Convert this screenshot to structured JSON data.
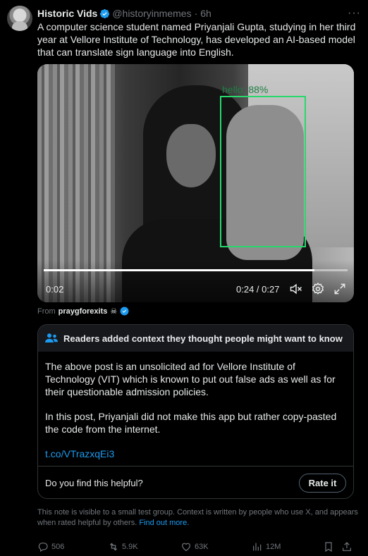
{
  "author": {
    "name": "Historic Vids",
    "handle": "@historyinmemes",
    "separator": "·",
    "time": "6h",
    "more": "···"
  },
  "tweet": {
    "text": "A computer science student named Priyanjali Gupta, studying in her third year at Vellore Institute of Technology, has developed an AI-based model that can translate sign language into English."
  },
  "video": {
    "detection_label": "hello: 88%",
    "current_time_left": "0:02",
    "time_display": "0:24 / 0:27",
    "progress": 0.89
  },
  "source": {
    "prefix": "From",
    "account": "praygforexits",
    "emoji": "☠"
  },
  "community_note": {
    "header": "Readers added context they thought people might want to know",
    "paragraph1": "The above post is an unsolicited ad for Vellore Institute of Technology (VIT) which is known to put out false ads as well as for their questionable admission policies.",
    "paragraph2": "In this post, Priyanjali did not make this app but rather copy-pasted the code from the internet.",
    "link": "t.co/VTrazxqEi3",
    "helpful_question": "Do you find this helpful?",
    "rate_button": "Rate it"
  },
  "disclaimer": {
    "text": "This note is visible to a small test group. Context is written by people who use X, and appears when rated helpful by others.",
    "find_out_more": "Find out more."
  },
  "actions": {
    "replies": "506",
    "reposts": "5.9K",
    "likes": "63K",
    "views": "12M"
  },
  "colors": {
    "background": "#000000",
    "accent": "#1d9bf0",
    "detection_box": "#27d86b",
    "muted": "#71767b"
  }
}
